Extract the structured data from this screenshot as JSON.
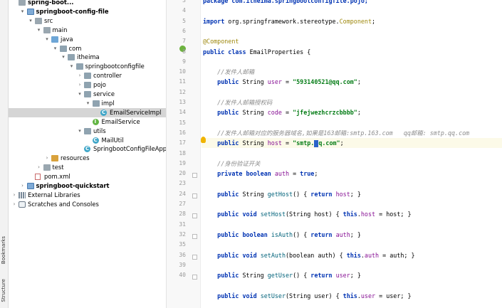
{
  "side_tabs": {
    "bookmarks": "Bookmarks",
    "structure": "Structure"
  },
  "tree": [
    {
      "label": "spring-boot...",
      "icon": "folder-icon",
      "depth": 0,
      "arrow": "",
      "bold": true
    },
    {
      "label": "springboot-config-file",
      "icon": "module-folder-icon",
      "depth": 1,
      "arrow": "▾",
      "bold": true
    },
    {
      "label": "src",
      "icon": "folder-icon",
      "depth": 2,
      "arrow": "▾"
    },
    {
      "label": "main",
      "icon": "folder-icon",
      "depth": 3,
      "arrow": "▾"
    },
    {
      "label": "java",
      "icon": "source-folder-icon",
      "depth": 4,
      "arrow": "▾"
    },
    {
      "label": "com",
      "icon": "package-icon",
      "depth": 5,
      "arrow": "▾"
    },
    {
      "label": "itheima",
      "icon": "package-icon",
      "depth": 6,
      "arrow": "▾"
    },
    {
      "label": "springbootconfigfile",
      "icon": "package-icon",
      "depth": 7,
      "arrow": "▾"
    },
    {
      "label": "controller",
      "icon": "package-icon",
      "depth": 8,
      "arrow": "›"
    },
    {
      "label": "pojo",
      "icon": "package-icon",
      "depth": 8,
      "arrow": "›"
    },
    {
      "label": "service",
      "icon": "package-icon",
      "depth": 8,
      "arrow": "▾"
    },
    {
      "label": "impl",
      "icon": "package-icon",
      "depth": 9,
      "arrow": "▾"
    },
    {
      "label": "EmailServiceImpl",
      "icon": "class-icon",
      "depth": 10,
      "arrow": "",
      "selected": true
    },
    {
      "label": "EmailService",
      "icon": "interface-icon",
      "depth": 9,
      "arrow": ""
    },
    {
      "label": "utils",
      "icon": "package-icon",
      "depth": 8,
      "arrow": "▾"
    },
    {
      "label": "MailUtil",
      "icon": "class-icon",
      "depth": 9,
      "arrow": ""
    },
    {
      "label": "SpringbootConfigFileAppli",
      "icon": "class-icon",
      "depth": 8,
      "arrow": ""
    },
    {
      "label": "resources",
      "icon": "resources-folder-icon",
      "depth": 4,
      "arrow": "›"
    },
    {
      "label": "test",
      "icon": "folder-icon",
      "depth": 3,
      "arrow": "›"
    },
    {
      "label": "pom.xml",
      "icon": "maven-file-icon",
      "depth": 2,
      "arrow": ""
    },
    {
      "label": "springboot-quickstart",
      "icon": "module-folder-icon",
      "depth": 1,
      "arrow": "›",
      "bold": true
    },
    {
      "label": "External Libraries",
      "icon": "libraries-icon",
      "depth": 0,
      "arrow": "›"
    },
    {
      "label": "Scratches and Consoles",
      "icon": "scratches-icon",
      "depth": 0,
      "arrow": "›"
    }
  ],
  "gutter": {
    "line_numbers": [
      "3",
      "4",
      "5",
      "6",
      "7",
      "8",
      "9",
      "10",
      "11",
      "12",
      "13",
      "14",
      "15",
      "16",
      "17",
      "18",
      "19",
      "20",
      "23",
      "24",
      "27",
      "28",
      "31",
      "32",
      "35",
      "36",
      "39",
      "40"
    ]
  },
  "code_lines": [
    [
      {
        "t": "package com.itheima.springbootconfigfile.pojo;",
        "c": "kw"
      }
    ],
    [
      {
        "t": ""
      }
    ],
    [
      {
        "t": "import ",
        "c": "kw"
      },
      {
        "t": "org.springframework.stereotype."
      },
      {
        "t": "Component",
        "c": "ann"
      },
      {
        "t": ";"
      }
    ],
    [
      {
        "t": ""
      }
    ],
    [
      {
        "t": "@Component",
        "c": "ann"
      }
    ],
    [
      {
        "t": "public class ",
        "c": "kw"
      },
      {
        "t": "EmailProperties {"
      }
    ],
    [
      {
        "t": ""
      }
    ],
    [
      {
        "t": "    //发件人邮箱",
        "c": "cm"
      }
    ],
    [
      {
        "t": "    "
      },
      {
        "t": "public ",
        "c": "kw"
      },
      {
        "t": "String "
      },
      {
        "t": "user",
        "c": "fld"
      },
      {
        "t": " = "
      },
      {
        "t": "\"593140521@qq.com\"",
        "c": "str"
      },
      {
        "t": ";"
      }
    ],
    [
      {
        "t": ""
      }
    ],
    [
      {
        "t": "    //发件人邮箱授权码",
        "c": "cm"
      }
    ],
    [
      {
        "t": "    "
      },
      {
        "t": "public ",
        "c": "kw"
      },
      {
        "t": "String "
      },
      {
        "t": "code",
        "c": "fld"
      },
      {
        "t": " = "
      },
      {
        "t": "\"jfejwezhcrzcbbbb\"",
        "c": "str"
      },
      {
        "t": ";"
      }
    ],
    [
      {
        "t": ""
      }
    ],
    [
      {
        "t": "    //发件人邮箱对应的服务器域名,如果是163邮箱:smtp.163.com   qq邮箱: smtp.qq.com",
        "c": "cm"
      }
    ],
    [
      {
        "t": "    "
      },
      {
        "t": "public ",
        "c": "kw"
      },
      {
        "t": "String "
      },
      {
        "t": "host",
        "c": "fld"
      },
      {
        "t": " = "
      },
      {
        "t": "\"smtp.",
        "c": "str"
      },
      {
        "t": "CURSOR"
      },
      {
        "t": "q.com\"",
        "c": "str"
      },
      {
        "t": ";"
      }
    ],
    [
      {
        "t": ""
      }
    ],
    [
      {
        "t": "    //身份验证开关",
        "c": "cm"
      }
    ],
    [
      {
        "t": "    "
      },
      {
        "t": "private boolean ",
        "c": "kw"
      },
      {
        "t": "auth",
        "c": "fld"
      },
      {
        "t": " = "
      },
      {
        "t": "true",
        "c": "kw"
      },
      {
        "t": ";"
      }
    ],
    [
      {
        "t": ""
      }
    ],
    [
      {
        "t": "    "
      },
      {
        "t": "public ",
        "c": "kw"
      },
      {
        "t": "String "
      },
      {
        "t": "getHost",
        "c": "mth"
      },
      {
        "t": "() { "
      },
      {
        "t": "return ",
        "c": "kw"
      },
      {
        "t": "host",
        "c": "fld"
      },
      {
        "t": "; }"
      }
    ],
    [
      {
        "t": ""
      }
    ],
    [
      {
        "t": "    "
      },
      {
        "t": "public void ",
        "c": "kw"
      },
      {
        "t": "setHost",
        "c": "mth"
      },
      {
        "t": "(String host) { "
      },
      {
        "t": "this",
        "c": "kw"
      },
      {
        "t": "."
      },
      {
        "t": "host",
        "c": "fld"
      },
      {
        "t": " = host; }"
      }
    ],
    [
      {
        "t": ""
      }
    ],
    [
      {
        "t": "    "
      },
      {
        "t": "public boolean ",
        "c": "kw"
      },
      {
        "t": "isAuth",
        "c": "mth"
      },
      {
        "t": "() { "
      },
      {
        "t": "return ",
        "c": "kw"
      },
      {
        "t": "auth",
        "c": "fld"
      },
      {
        "t": "; }"
      }
    ],
    [
      {
        "t": ""
      }
    ],
    [
      {
        "t": "    "
      },
      {
        "t": "public void ",
        "c": "kw"
      },
      {
        "t": "setAuth",
        "c": "mth"
      },
      {
        "t": "(boolean auth) { "
      },
      {
        "t": "this",
        "c": "kw"
      },
      {
        "t": "."
      },
      {
        "t": "auth",
        "c": "fld"
      },
      {
        "t": " = auth; }"
      }
    ],
    [
      {
        "t": ""
      }
    ],
    [
      {
        "t": "    "
      },
      {
        "t": "public ",
        "c": "kw"
      },
      {
        "t": "String "
      },
      {
        "t": "getUser",
        "c": "mth"
      },
      {
        "t": "() { "
      },
      {
        "t": "return ",
        "c": "kw"
      },
      {
        "t": "user",
        "c": "fld"
      },
      {
        "t": "; }"
      }
    ],
    [
      {
        "t": ""
      }
    ],
    [
      {
        "t": "    "
      },
      {
        "t": "public void ",
        "c": "kw"
      },
      {
        "t": "setUser",
        "c": "mth"
      },
      {
        "t": "(String user) { "
      },
      {
        "t": "this",
        "c": "kw"
      },
      {
        "t": "."
      },
      {
        "t": "user",
        "c": "fld"
      },
      {
        "t": " = user; }"
      }
    ]
  ]
}
